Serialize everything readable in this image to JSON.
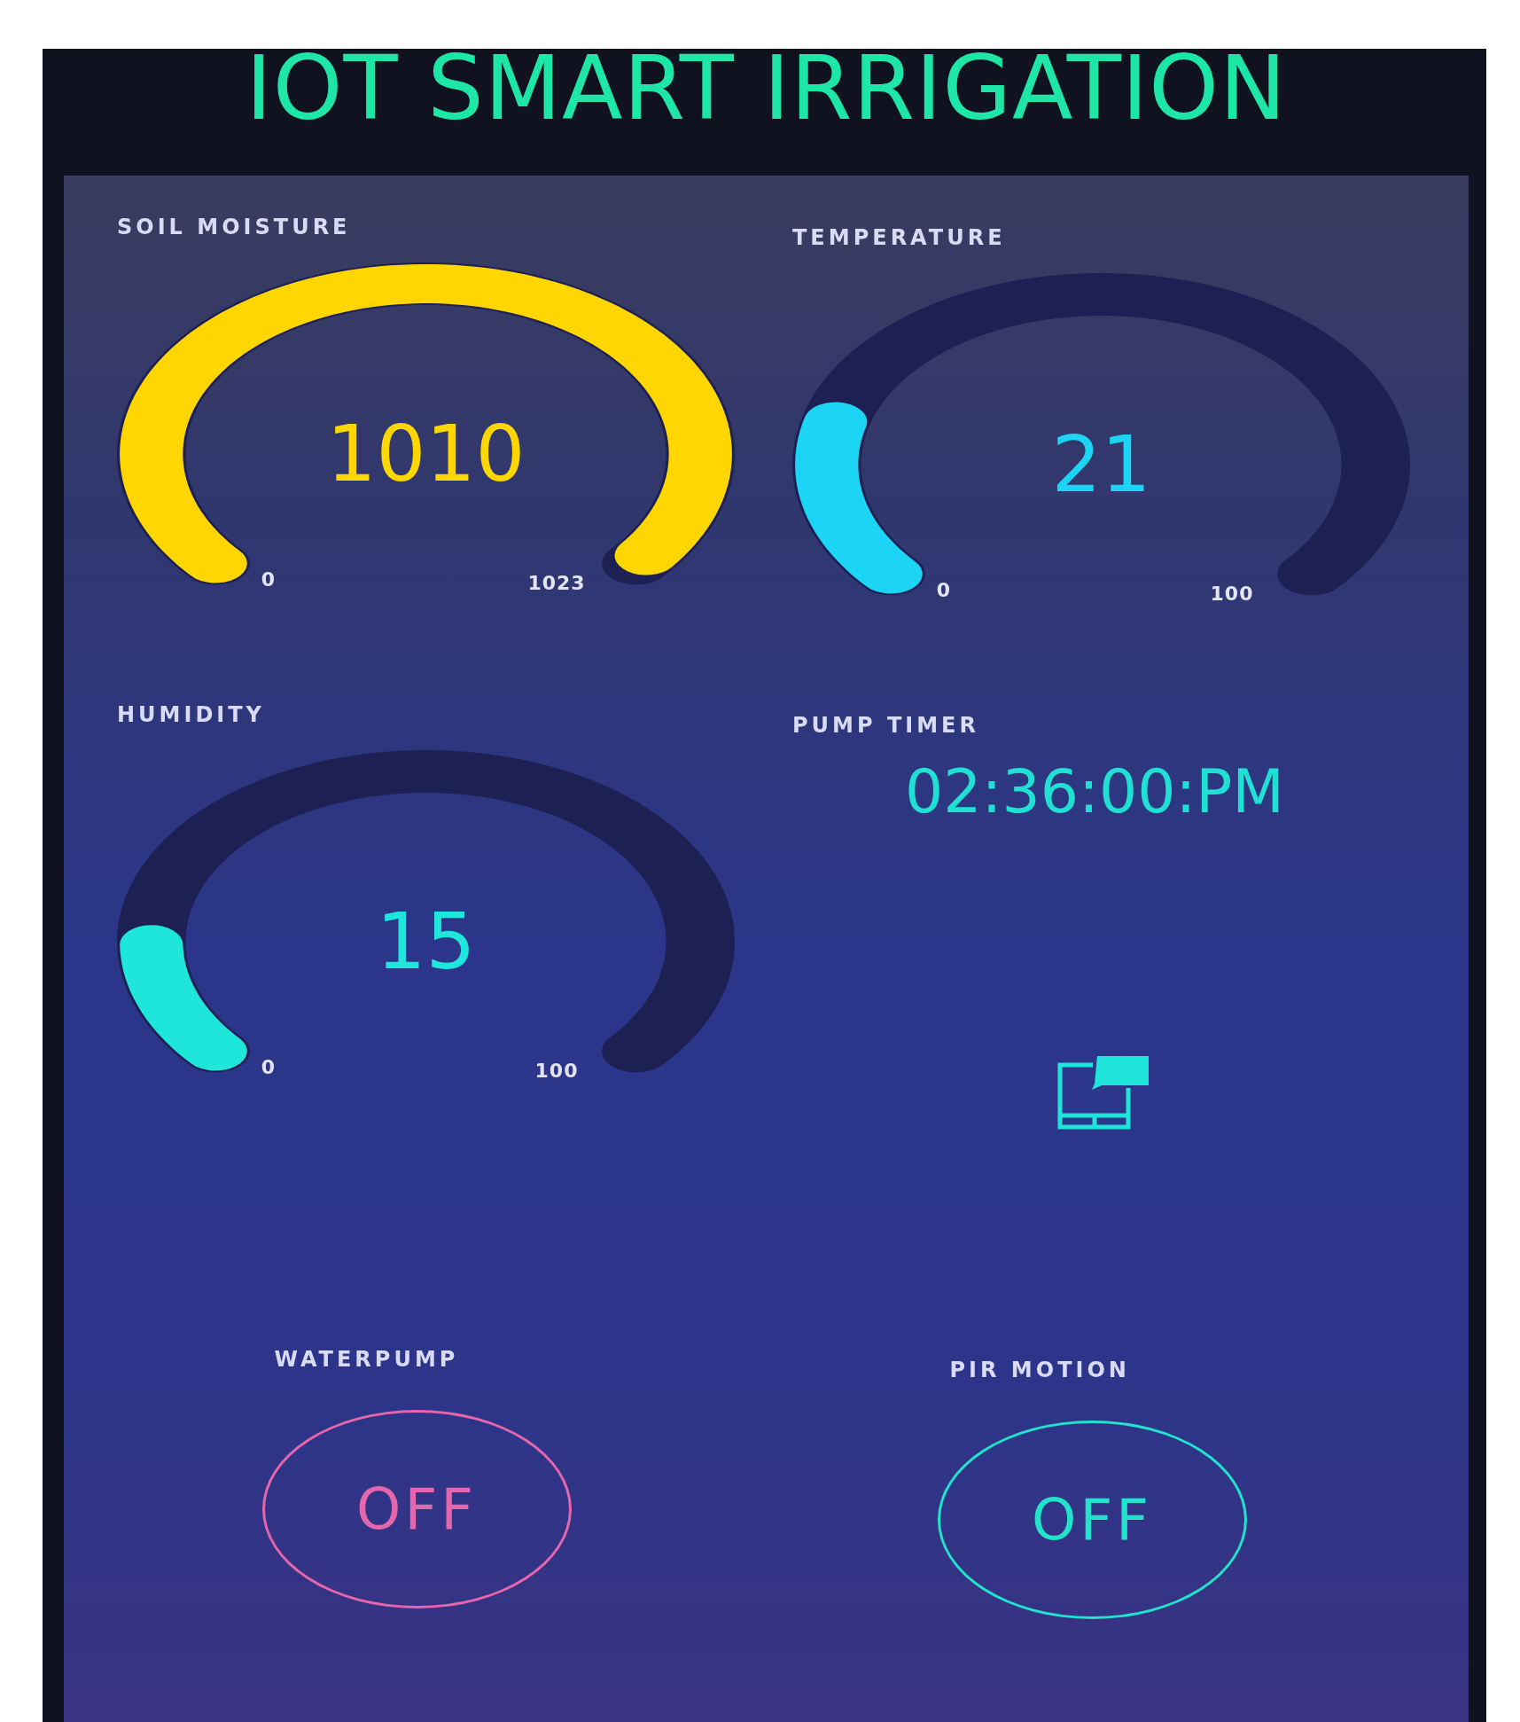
{
  "title": "IOT SMART IRRIGATION",
  "gauges": [
    {
      "label": "SOIL MOISTURE",
      "value": "1010",
      "min": "0",
      "max": "1023",
      "level": 0.987,
      "color": "#ffd600"
    },
    {
      "label": "TEMPERATURE",
      "value": "21",
      "min": "0",
      "max": "100",
      "level": 0.21,
      "color": "#1cd4f4"
    },
    {
      "label": "HUMIDITY",
      "value": "15",
      "min": "0",
      "max": "100",
      "level": 0.15,
      "color": "#1ee6da"
    }
  ],
  "pump_timer": {
    "label": "PUMP TIMER",
    "value": "02:36:00:PM"
  },
  "buttons": [
    {
      "label": "WATERPUMP",
      "text": "OFF",
      "on": false,
      "color": "#e466ac"
    },
    {
      "label": "PIR MOTION",
      "text": "OFF",
      "on": false,
      "color": "#22e2cc"
    }
  ]
}
